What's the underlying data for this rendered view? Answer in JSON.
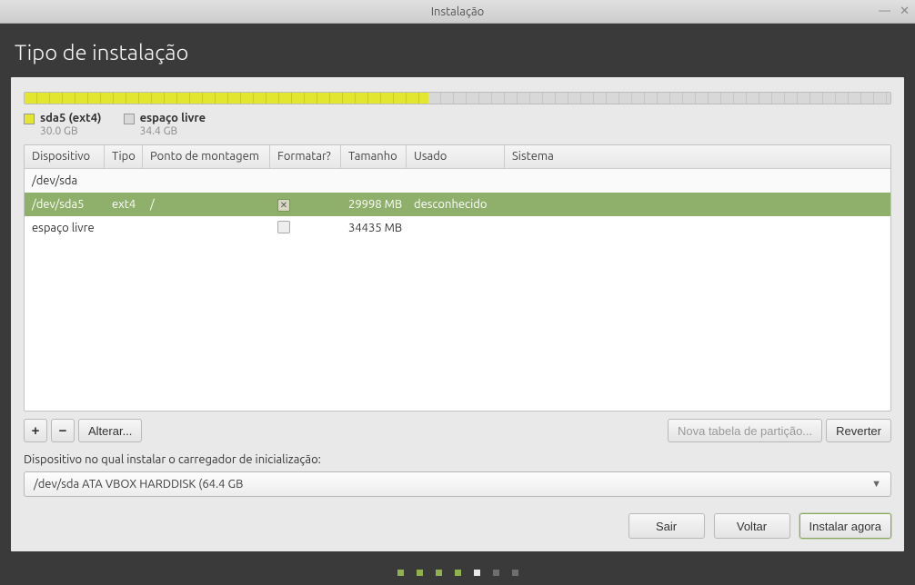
{
  "window": {
    "title": "Instalação"
  },
  "page": {
    "title": "Tipo de instalação"
  },
  "legend": {
    "sda5": {
      "label": "sda5 (ext4)",
      "size": "30.0 GB"
    },
    "free": {
      "label": "espaço livre",
      "size": "34.4 GB"
    }
  },
  "table": {
    "headers": {
      "device": "Dispositivo",
      "type": "Tipo",
      "mount": "Ponto de montagem",
      "format": "Formatar?",
      "size": "Tamanho",
      "used": "Usado",
      "system": "Sistema"
    },
    "rows": {
      "parent": {
        "device": "/dev/sda"
      },
      "sda5": {
        "device": "/dev/sda5",
        "type": "ext4",
        "mount": "/",
        "size": "29998 MB",
        "used": "desconhecido"
      },
      "free": {
        "device": "espaço livre",
        "size": "34435 MB"
      }
    }
  },
  "buttons": {
    "add": "+",
    "remove": "−",
    "change": "Alterar...",
    "newtable": "Nova tabela de partição...",
    "revert": "Reverter"
  },
  "bootloader": {
    "label": "Dispositivo no qual instalar o carregador de inicialização:",
    "value": "/dev/sda   ATA VBOX HARDDISK (64.4 GB"
  },
  "nav": {
    "quit": "Sair",
    "back": "Voltar",
    "install": "Instalar agora"
  }
}
